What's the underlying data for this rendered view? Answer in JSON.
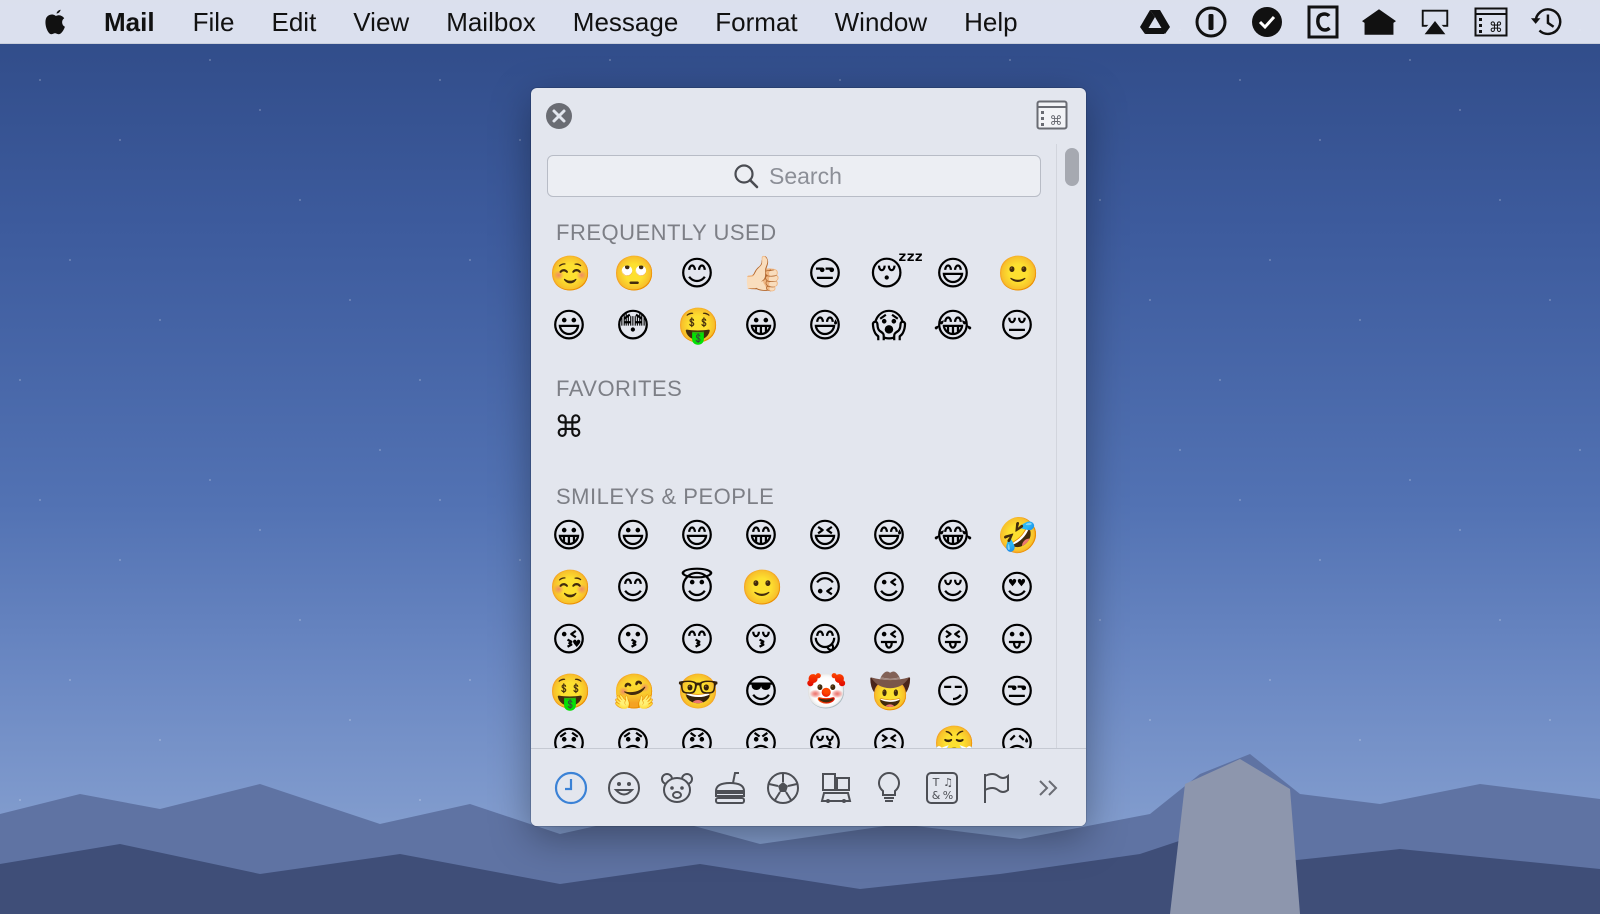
{
  "menubar": {
    "app_name": "Mail",
    "items": [
      "File",
      "Edit",
      "View",
      "Mailbox",
      "Message",
      "Format",
      "Window",
      "Help"
    ],
    "status_icons": [
      "google-drive-icon",
      "1password-icon",
      "todo-check-icon",
      "clipboard-c-icon",
      "home-icon",
      "airplay-icon",
      "keyboard-viewer-icon",
      "time-machine-icon"
    ]
  },
  "panel": {
    "search_placeholder": "Search",
    "sections": {
      "frequently_used": {
        "title": "FREQUENTLY USED",
        "emoji": [
          "☺️",
          "🙄",
          "😊",
          "👍🏻",
          "😒",
          "😴",
          "😄",
          "🙂",
          "😃",
          "😳",
          "🤑",
          "😀",
          "😅",
          "😱",
          "😂",
          "😔"
        ]
      },
      "favorites": {
        "title": "FAVORITES",
        "items": [
          "⌘"
        ]
      },
      "smileys": {
        "title": "SMILEYS & PEOPLE",
        "emoji": [
          "😀",
          "😃",
          "😄",
          "😁",
          "😆",
          "😅",
          "😂",
          "🤣",
          "☺️",
          "😊",
          "😇",
          "🙂",
          "🙃",
          "😉",
          "😌",
          "😍",
          "😘",
          "😗",
          "😙",
          "😚",
          "😋",
          "😜",
          "😝",
          "😛",
          "🤑",
          "🤗",
          "🤓",
          "😎",
          "🤡",
          "🤠",
          "😏",
          "😒",
          "😞",
          "😟",
          "😠",
          "😡",
          "😢",
          "😣",
          "😤",
          "😥"
        ]
      }
    },
    "tabs": [
      "recent-clock-icon",
      "smiley-icon",
      "bear-icon",
      "food-icon",
      "soccer-ball-icon",
      "buildings-car-icon",
      "lightbulb-icon",
      "symbols-icon",
      "flag-icon",
      "more-chevrons-icon"
    ],
    "accent_color": "#3b82d6"
  }
}
